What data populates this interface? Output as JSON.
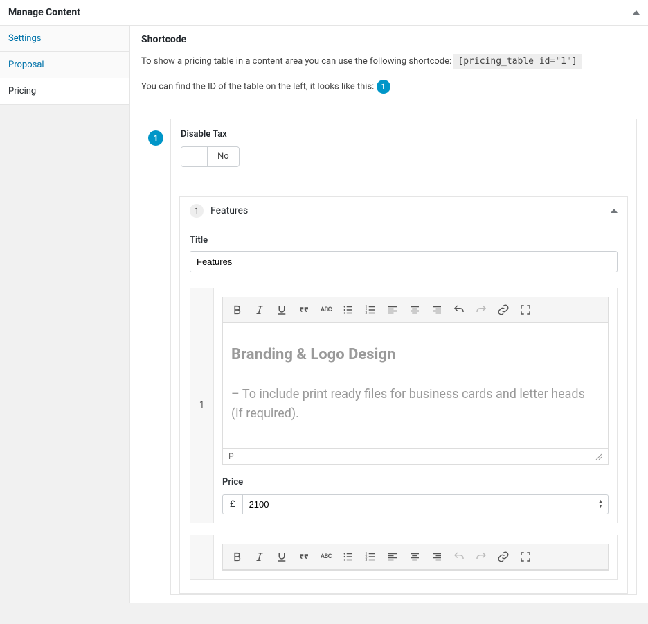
{
  "header": {
    "title": "Manage Content"
  },
  "sidebar": {
    "items": [
      {
        "label": "Settings"
      },
      {
        "label": "Proposal"
      },
      {
        "label": "Pricing"
      }
    ],
    "active_index": 2
  },
  "shortcode": {
    "heading": "Shortcode",
    "intro": "To show a pricing table in a content area you can use the following shortcode: ",
    "code": "[pricing_table id=\"1\"]",
    "idhelp": "You can find the ID of the table on the left, it looks like this:",
    "example_id": "1"
  },
  "table": {
    "id_badge": "1",
    "disable_tax": {
      "label": "Disable Tax",
      "state": "No"
    },
    "features_section": {
      "index": "1",
      "title": "Features",
      "title_field_label": "Title",
      "title_value": "Features",
      "feature_item": {
        "index": "1",
        "content_heading": "Branding & Logo Design",
        "content_body": "– To include print ready files for business cards and letter heads (if required).",
        "path": "P",
        "price_label": "Price",
        "currency": "£",
        "price_value": "2100"
      }
    }
  },
  "toolbar": {
    "buttons": [
      "bold",
      "italic",
      "underline",
      "blockquote",
      "abc",
      "ul",
      "ol",
      "align-left",
      "align-center",
      "align-right",
      "undo",
      "redo",
      "link",
      "fullscreen"
    ]
  }
}
